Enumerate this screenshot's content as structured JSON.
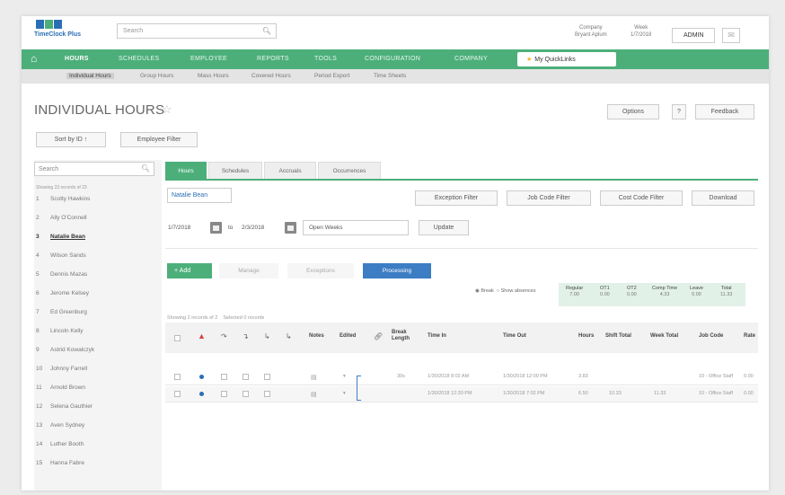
{
  "app": {
    "logo_text": "TimeClock Plus",
    "search_placeholder": "Search",
    "company_label": "Company",
    "company_value": "Bryant Aplum",
    "week_label": "Week",
    "week_value": "1/7/2018",
    "user": "ADMIN"
  },
  "nav": {
    "items": [
      "HOURS",
      "SCHEDULES",
      "EMPLOYEE",
      "REPORTS",
      "TOOLS",
      "CONFIGURATION",
      "COMPANY"
    ],
    "quicklinks": "My QuickLinks"
  },
  "subnav": {
    "items": [
      "Individual Hours",
      "Group Hours",
      "Mass Hours",
      "Covered Hours",
      "Period Export",
      "Time Sheets"
    ]
  },
  "page": {
    "title": "INDIVIDUAL HOURS",
    "options": "Options",
    "help": "?",
    "feedback": "Feedback",
    "sort": "Sort by ID ↑",
    "employee_filter": "Employee Filter"
  },
  "sidebar": {
    "search_placeholder": "Search",
    "showing": "Showing 23 records of 23",
    "employees": [
      {
        "num": "1",
        "name": "Scotty Hawkins"
      },
      {
        "num": "2",
        "name": "Ally O'Connell"
      },
      {
        "num": "3",
        "name": "Natalie Bean"
      },
      {
        "num": "4",
        "name": "Wilson Sands"
      },
      {
        "num": "5",
        "name": "Dennis Mazas"
      },
      {
        "num": "6",
        "name": "Jerome Kelsey"
      },
      {
        "num": "7",
        "name": "Ed Greenburg"
      },
      {
        "num": "8",
        "name": "Lincoln Kelly"
      },
      {
        "num": "9",
        "name": "Astrid Kowalczyk"
      },
      {
        "num": "10",
        "name": "Johnny Farrell"
      },
      {
        "num": "11",
        "name": "Arnold Brown"
      },
      {
        "num": "12",
        "name": "Selena Gauthier"
      },
      {
        "num": "13",
        "name": "Aven Sydney"
      },
      {
        "num": "14",
        "name": "Luther Booth"
      },
      {
        "num": "15",
        "name": "Hanna Fabre"
      }
    ]
  },
  "tabs": [
    "Hours",
    "Schedules",
    "Accruals",
    "Occurrences"
  ],
  "main": {
    "employee": "Natalie Bean",
    "exception_filter": "Exception Filter",
    "job_code_filter": "Job Code Filter",
    "cost_code_filter": "Cost Code Filter",
    "download": "Download",
    "date_from": "1/7/2018",
    "date_to_label": "to",
    "date_to": "2/3/2018",
    "range_select": "Open Weeks",
    "update": "Update",
    "add": "+ Add",
    "manage": "Manage",
    "exceptions": "Exceptions",
    "processing": "Processing",
    "radio_break": "Break",
    "radio_show": "Show absences",
    "totals": [
      {
        "label": "Regular",
        "value": "7.00"
      },
      {
        "label": "OT1",
        "value": "0.00"
      },
      {
        "label": "OT2",
        "value": "0.00"
      },
      {
        "label": "Comp Time",
        "value": "4.33"
      },
      {
        "label": "Leave",
        "value": "0.00"
      },
      {
        "label": "Total",
        "value": "11.33"
      }
    ],
    "showing": "Showing 2 records of 2",
    "selected": "Selected 0 records"
  },
  "grid": {
    "headers": [
      "Notes",
      "Edited",
      "Break Length",
      "Time In",
      "Time Out",
      "Hours",
      "Shift Total",
      "Week Total",
      "Job Code",
      "Rate"
    ],
    "rows": [
      {
        "break": "30s",
        "time_in": "1/30/2018 8:02 AM",
        "time_out": "1/30/2018 12:00 PM",
        "hours": "3.83",
        "shift_total": "",
        "week_total": "",
        "job_code": "10 - Office Staff",
        "rate": "0.00"
      },
      {
        "break": "",
        "time_in": "1/30/2018 12:30 PM",
        "time_out": "1/30/2018 7:02 PM",
        "hours": "6.50",
        "shift_total": "10.33",
        "week_total": "11.33",
        "job_code": "10 - Office Staff",
        "rate": "0.00"
      }
    ]
  }
}
